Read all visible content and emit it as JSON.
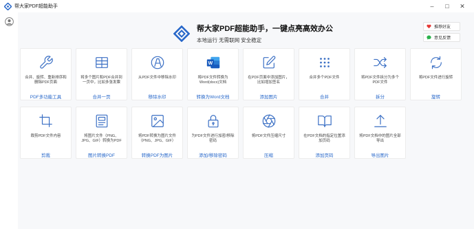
{
  "window": {
    "title": "帮大家PDF超能助手",
    "controls": [
      "–",
      "□",
      "✕"
    ]
  },
  "hero": {
    "title": "帮大家PDF超能助手，一键点亮高效办公",
    "subtitle": "本地运行 无需联网 安全稳定"
  },
  "side": {
    "recommend_label": "推荐好友",
    "feedback_label": "意见反馈"
  },
  "colors": {
    "accent": "#2767c9",
    "icon": "#3a6fc4",
    "heart": "#e53935",
    "chat": "#2bb24c",
    "word": "#2b6cd2"
  },
  "tools": [
    {
      "icon": "wrench-icon",
      "desc": "合并、旋转、重新排序和删除PDF页面",
      "name": "PDF多功能工具"
    },
    {
      "icon": "grid-icon",
      "desc": "将多个图片和PDF合并到一页中，比如多张发票",
      "name": "合并一页"
    },
    {
      "icon": "watermark-icon",
      "desc": "从PDF文件中移除水印",
      "name": "移除水印"
    },
    {
      "icon": "word-icon",
      "desc": "将PDF文件转换为Word(docx)文档",
      "name": "转换为Word文档"
    },
    {
      "icon": "edit-icon",
      "desc": "在PDF页面中添加图片，比如增加签名",
      "name": "添加图片"
    },
    {
      "icon": "dots-icon",
      "desc": "合并多个PDF文件",
      "name": "合并"
    },
    {
      "icon": "split-icon",
      "desc": "将PDF文件拆分为多个PDF文件",
      "name": "拆分"
    },
    {
      "icon": "rotate-icon",
      "desc": "将PDF文件进行旋转",
      "name": "旋转"
    },
    {
      "icon": "crop-icon",
      "desc": "裁剪PDF文件内容",
      "name": "剪裁"
    },
    {
      "icon": "image-card-icon",
      "desc": "将图片文件（PNG、JPG、GIF）转换为PDF",
      "name": "图片转换PDF"
    },
    {
      "icon": "picture-icon",
      "desc": "将PDF转换为图片文件（PNG、JPG、GIF）",
      "name": "转换PDF为图片"
    },
    {
      "icon": "lock-icon",
      "desc": "为PDF文件进行加密/移除密码",
      "name": "添加/移除密码"
    },
    {
      "icon": "aperture-icon",
      "desc": "将PDF文件压缩尺寸",
      "name": "压缩"
    },
    {
      "icon": "book-icon",
      "desc": "在PDF文档的指定位置添加页码",
      "name": "添加页码"
    },
    {
      "icon": "export-icon",
      "desc": "将PDF文档中的图片全部导出",
      "name": "导出图片"
    }
  ]
}
